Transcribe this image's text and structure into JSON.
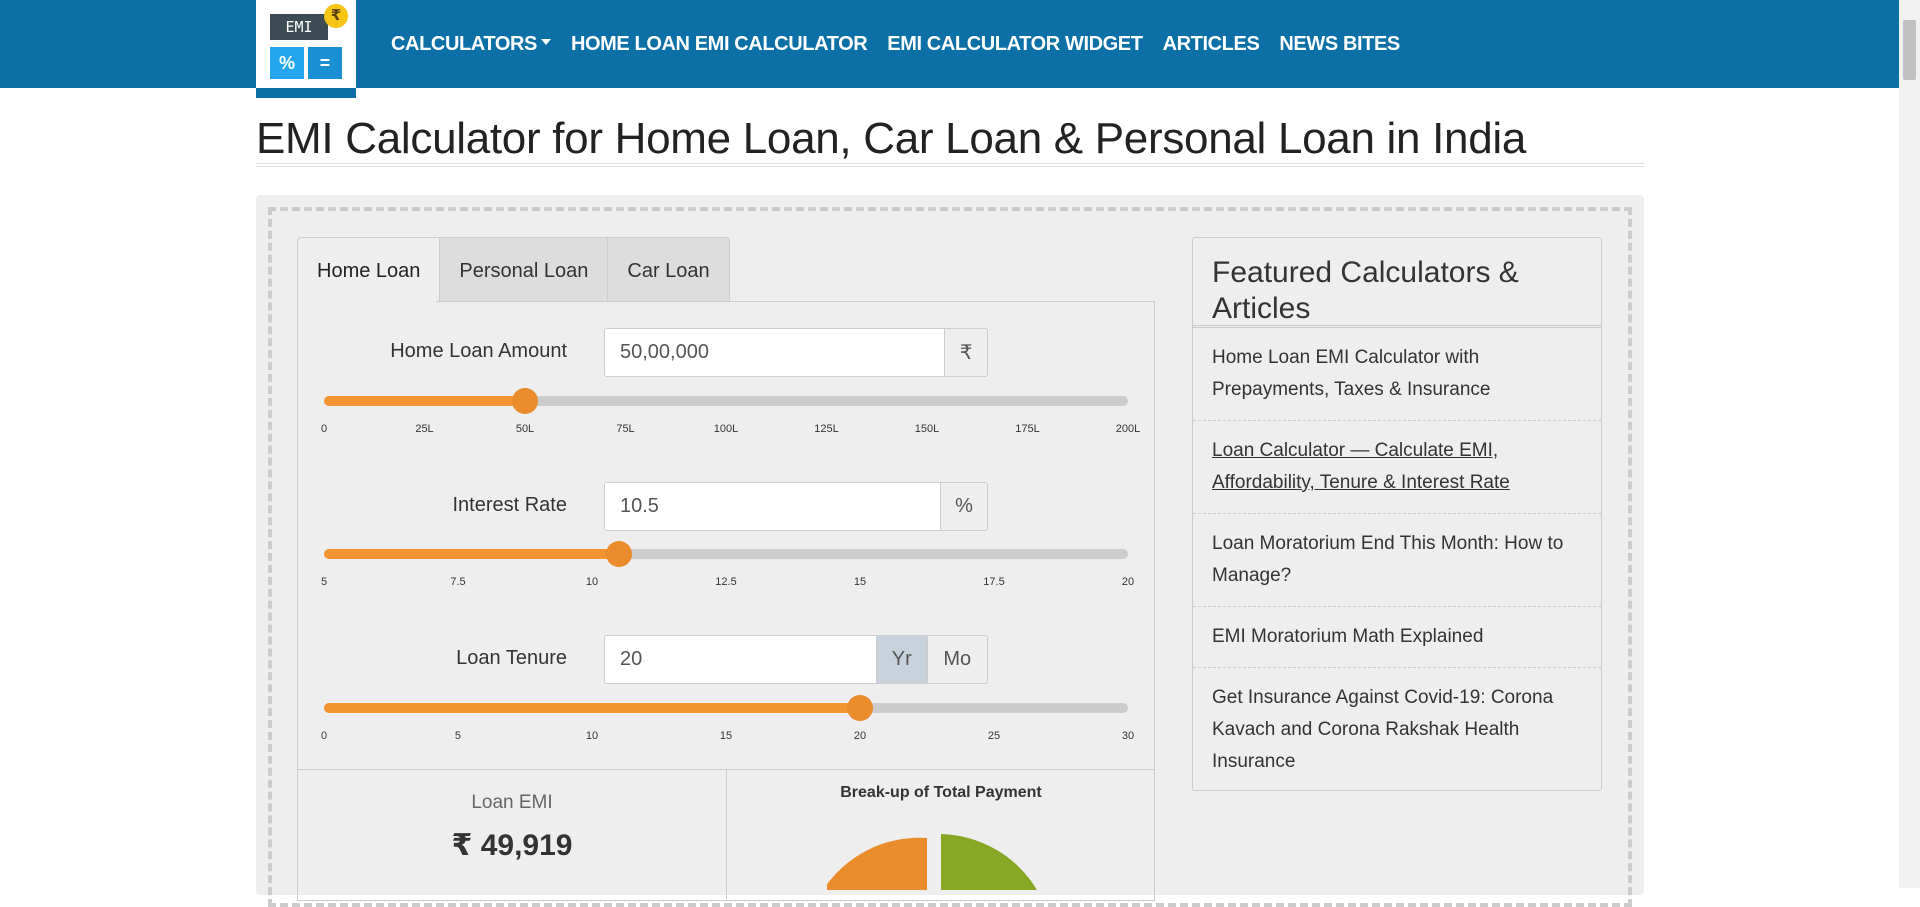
{
  "nav": {
    "logo": {
      "screen_text": "EMI",
      "btn_pct": "%",
      "btn_eq": "=",
      "coin": "₹"
    },
    "calculators": "CALCULATORS",
    "home_loan_emi": "HOME LOAN EMI CALCULATOR",
    "widget": "EMI CALCULATOR WIDGET",
    "articles": "ARTICLES",
    "news": "NEWS BITES"
  },
  "page_title": "EMI Calculator for Home Loan, Car Loan & Personal Loan in India",
  "tabs": [
    "Home Loan",
    "Personal Loan",
    "Car Loan"
  ],
  "loan_amount": {
    "label": "Home Loan Amount",
    "value": "50,00,000",
    "addon": "₹",
    "slider_fraction": 0.25,
    "ticks": [
      "0",
      "25L",
      "50L",
      "75L",
      "100L",
      "125L",
      "150L",
      "175L",
      "200L"
    ]
  },
  "interest": {
    "label": "Interest Rate",
    "value": "10.5",
    "addon": "%",
    "slider_fraction": 0.3667,
    "ticks": [
      "5",
      "7.5",
      "10",
      "12.5",
      "15",
      "17.5",
      "20"
    ]
  },
  "tenure": {
    "label": "Loan Tenure",
    "value": "20",
    "yr": "Yr",
    "mo": "Mo",
    "slider_fraction": 0.6667,
    "ticks": [
      "0",
      "5",
      "10",
      "15",
      "20",
      "25",
      "30"
    ]
  },
  "result": {
    "emi_label": "Loan EMI",
    "emi_value": "₹ 49,919",
    "chart_title": "Break-up of Total Payment"
  },
  "colors": {
    "nav": "#0c6fa6",
    "accent": "#f39433",
    "pie_green": "#88a825",
    "pie_orange": "#ea8c2b"
  },
  "featured": {
    "title": "Featured Calculators & Articles",
    "items": [
      "Home Loan EMI Calculator with Prepayments, Taxes & Insurance",
      "Loan Calculator — Calculate EMI, Affordability, Tenure & Interest Rate",
      "Loan Moratorium End This Month: How to Manage?",
      "EMI Moratorium Math Explained",
      "Get Insurance Against Covid-19: Corona Kavach and Corona Rakshak Health Insurance"
    ]
  }
}
